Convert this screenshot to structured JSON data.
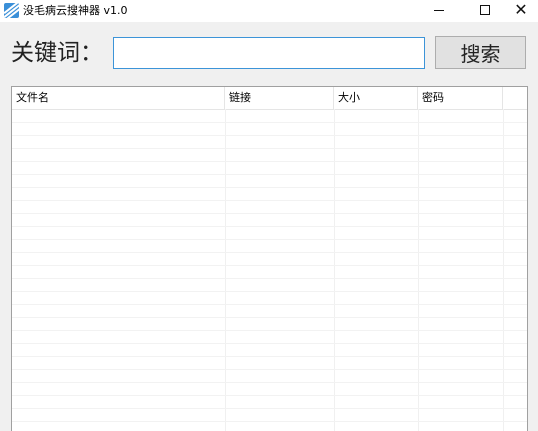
{
  "window": {
    "title": "没毛病云搜神器 v1.0",
    "icon": "app-logo-icon",
    "controls": {
      "minimize": "minimize-icon",
      "maximize": "maximize-icon",
      "close": "close-icon",
      "close_glyph": "✕"
    }
  },
  "search": {
    "label": "关键词：",
    "value": "",
    "button_label": "搜索"
  },
  "table": {
    "columns": [
      {
        "label": "文件名"
      },
      {
        "label": "链接"
      },
      {
        "label": "大小"
      },
      {
        "label": "密码"
      }
    ],
    "rows": []
  },
  "colors": {
    "window_bg": "#f0f0f0",
    "input_border": "#3c94d8",
    "button_bg": "#e1e1e1",
    "grid_line": "#f2f2f2"
  }
}
